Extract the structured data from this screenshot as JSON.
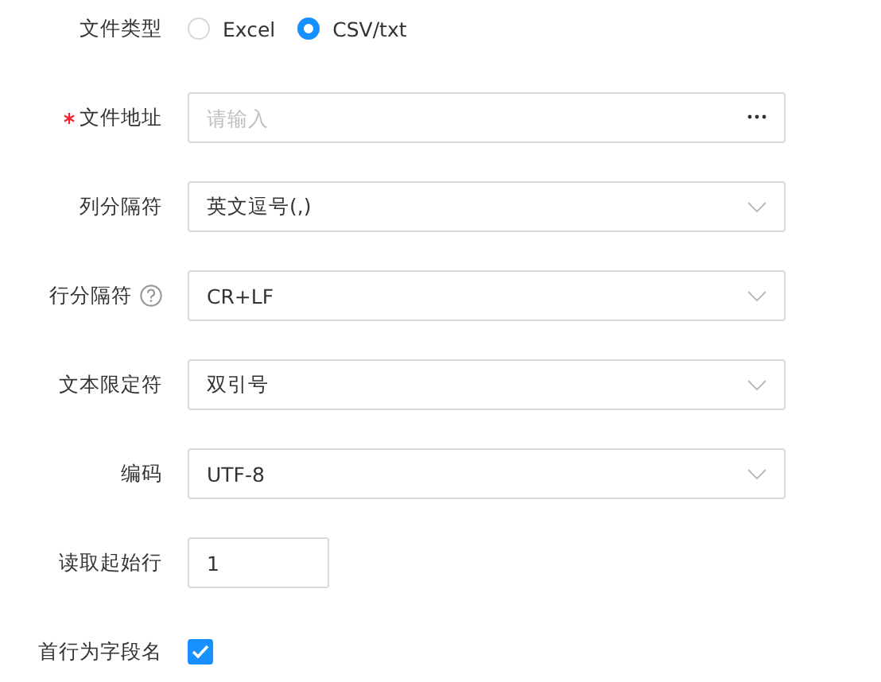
{
  "fields": [
    {
      "kind": "radio",
      "label": "文件类型",
      "required": false,
      "help": false,
      "options": [
        {
          "label": "Excel",
          "selected": false
        },
        {
          "label": "CSV/txt",
          "selected": true
        }
      ]
    },
    {
      "kind": "file",
      "label": "文件地址",
      "required": true,
      "help": false,
      "placeholder": "请输入"
    },
    {
      "kind": "select",
      "label": "列分隔符",
      "required": false,
      "help": false,
      "value": "英文逗号(,)"
    },
    {
      "kind": "select",
      "label": "行分隔符",
      "required": false,
      "help": true,
      "value": "CR+LF"
    },
    {
      "kind": "select",
      "label": "文本限定符",
      "required": false,
      "help": false,
      "value": "双引号"
    },
    {
      "kind": "select",
      "label": "编码",
      "required": false,
      "help": false,
      "value": "UTF-8"
    },
    {
      "kind": "number",
      "label": "读取起始行",
      "required": false,
      "help": false,
      "value": "1"
    },
    {
      "kind": "checkbox",
      "label": "首行为字段名",
      "required": false,
      "help": false,
      "checked": true
    }
  ]
}
